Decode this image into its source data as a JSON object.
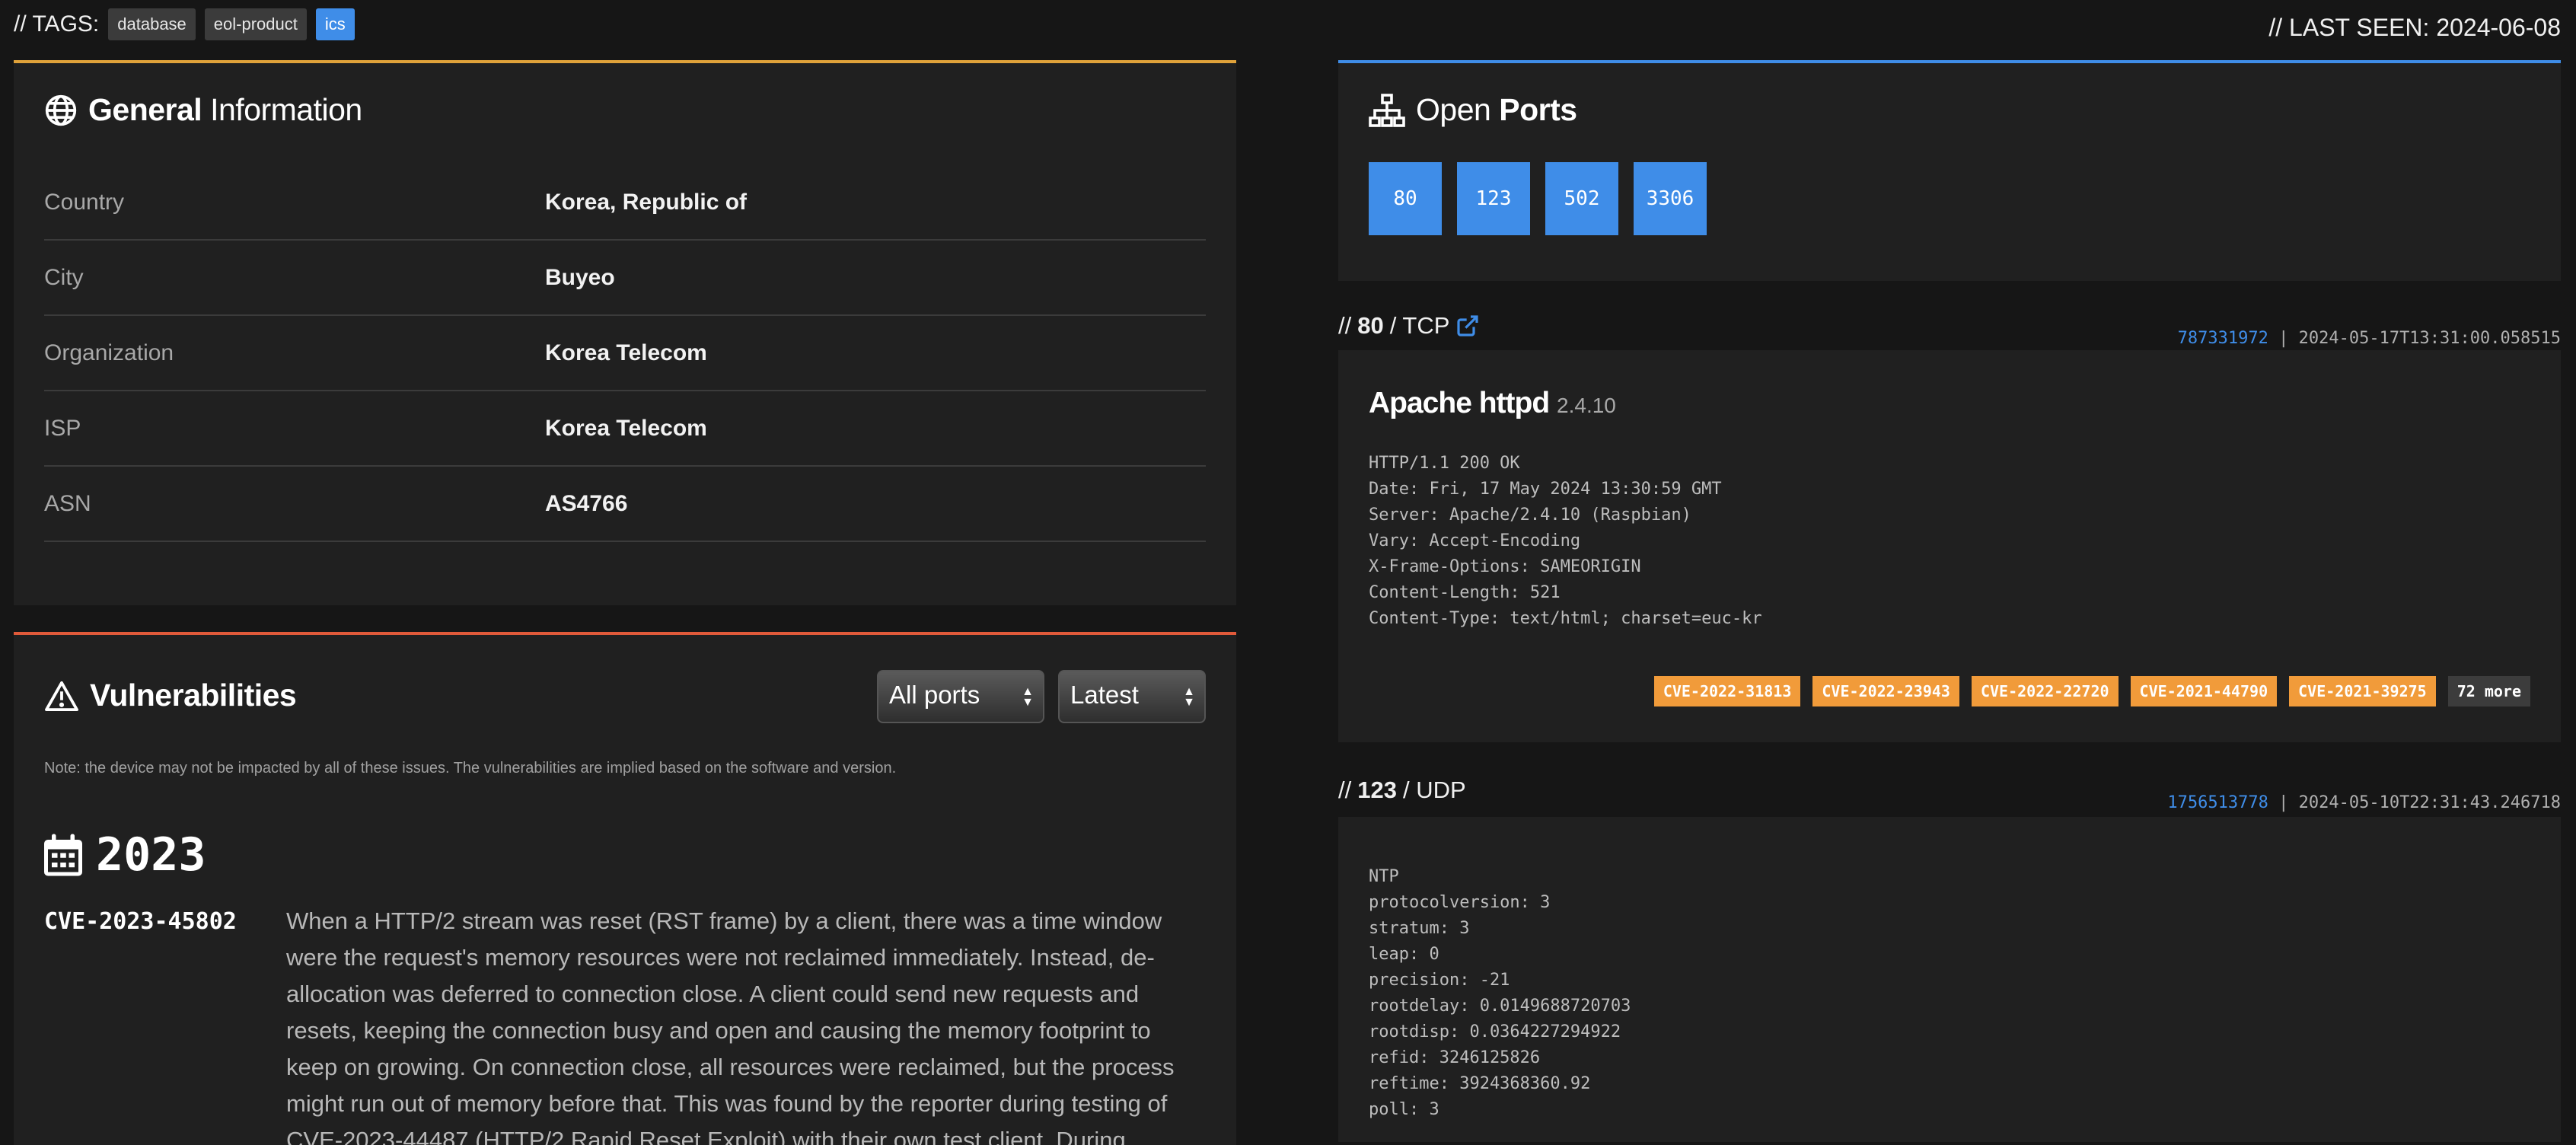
{
  "header": {
    "tags_label": "// TAGS:",
    "tags": [
      "database",
      "eol-product",
      "ics"
    ],
    "last_seen": "// LAST SEEN: 2024-06-08"
  },
  "general": {
    "title_bold": "General",
    "title_rest": "Information",
    "rows": [
      {
        "key": "Country",
        "value": "Korea, Republic of"
      },
      {
        "key": "City",
        "value": "Buyeo"
      },
      {
        "key": "Organization",
        "value": "Korea Telecom"
      },
      {
        "key": "ISP",
        "value": "Korea Telecom"
      },
      {
        "key": "ASN",
        "value": "AS4766"
      }
    ]
  },
  "vulnerabilities": {
    "title": "Vulnerabilities",
    "port_filter": "All ports",
    "sort_filter": "Latest",
    "note": "Note: the device may not be impacted by all of these issues. The vulnerabilities are implied based on the software and version.",
    "year": "2023",
    "items": [
      {
        "id": "CVE-2023-45802",
        "description": "When a HTTP/2 stream was reset (RST frame) by a client, there was a time window were the request's memory resources were not reclaimed immediately. Instead, de-allocation was deferred to connection close. A client could send new requests and resets, keeping the connection busy and open and causing the memory footprint to keep on growing. On connection close, all resources were reclaimed, but the process might run out of memory before that. This was found by the reporter during testing of CVE-2023-44487 (HTTP/2 Rapid Reset Exploit) with their own test client. During"
      }
    ]
  },
  "open_ports": {
    "title_light": "Open",
    "title_bold": "Ports",
    "ports": [
      "80",
      "123",
      "502",
      "3306"
    ]
  },
  "services": [
    {
      "prefix": "//",
      "port": "80",
      "protocol": "/ TCP",
      "hash": "787331972",
      "timestamp": "| 2024-05-17T13:31:00.058515",
      "product": "Apache httpd",
      "version": "2.4.10",
      "banner": "HTTP/1.1 200 OK\nDate: Fri, 17 May 2024 13:30:59 GMT\nServer: Apache/2.4.10 (Raspbian)\nVary: Accept-Encoding\nX-Frame-Options: SAMEORIGIN\nContent-Length: 521\nContent-Type: text/html; charset=euc-kr",
      "cves": [
        "CVE-2022-31813",
        "CVE-2022-23943",
        "CVE-2022-22720",
        "CVE-2021-44790",
        "CVE-2021-39275"
      ],
      "more": "72 more"
    },
    {
      "prefix": "//",
      "port": "123",
      "protocol": "/ UDP",
      "hash": "1756513778",
      "timestamp": "| 2024-05-10T22:31:43.246718",
      "banner": "NTP\nprotocolversion: 3\nstratum: 3\nleap: 0\nprecision: -21\nrootdelay: 0.0149688720703\nrootdisp: 0.0364227294922\nrefid: 3246125826\nreftime: 3924368360.92\npoll: 3"
    }
  ],
  "colors": {
    "general_accent": "#e0a23a",
    "vuln_accent": "#e05a3a",
    "ports_accent": "#3f8de8",
    "cve_badge": "#f19b3a"
  },
  "icons": {
    "general": "globe-icon",
    "vulnerabilities": "warning-icon",
    "ports": "network-icon",
    "year": "calendar-icon",
    "external_link": "external-link-icon"
  }
}
